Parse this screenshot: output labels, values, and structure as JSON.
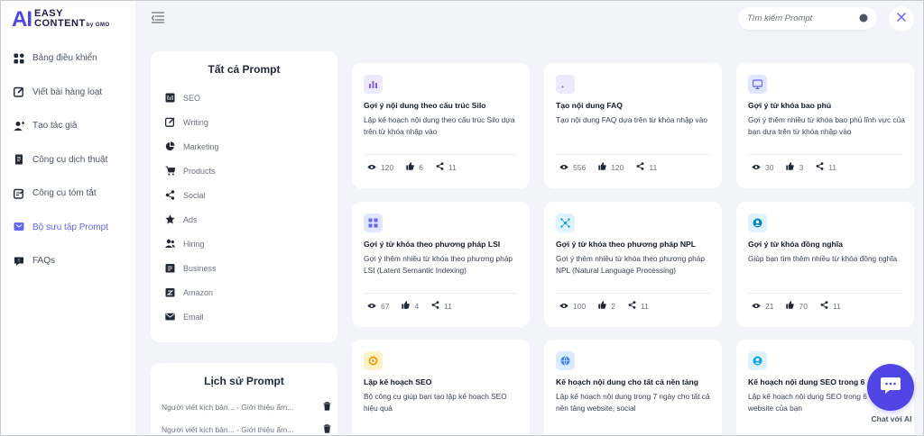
{
  "brand": {
    "mark": "AI",
    "line1": "EASY",
    "line2": "CONTENT",
    "sub": "by GMO"
  },
  "sidebar": {
    "items": [
      {
        "label": "Bảng điều khiển",
        "icon": "dashboard-icon"
      },
      {
        "label": "Viết bài hàng loạt",
        "icon": "edit-icon"
      },
      {
        "label": "Tạo tác giả",
        "icon": "user-add-icon"
      },
      {
        "label": "Công cụ dịch thuật",
        "icon": "document-icon"
      },
      {
        "label": "Công cụ tóm tắt",
        "icon": "summary-icon"
      },
      {
        "label": "Bộ sưu tập Prompt",
        "icon": "collection-icon",
        "active": true
      },
      {
        "label": "FAQs",
        "icon": "faq-icon"
      }
    ]
  },
  "search": {
    "placeholder": "Tìm kiếm Prompt"
  },
  "categories": {
    "title": "Tất cả Prompt",
    "items": [
      {
        "label": "SEO",
        "icon": "seo-icon"
      },
      {
        "label": "Writing",
        "icon": "pen-icon"
      },
      {
        "label": "Marketing",
        "icon": "pie-chart-icon"
      },
      {
        "label": "Products",
        "icon": "cart-icon"
      },
      {
        "label": "Social",
        "icon": "share-icon"
      },
      {
        "label": "Ads",
        "icon": "badge-icon"
      },
      {
        "label": "Hiring",
        "icon": "users-icon"
      },
      {
        "label": "Business",
        "icon": "briefcase-icon"
      },
      {
        "label": "Amazon",
        "icon": "amazon-icon"
      },
      {
        "label": "Email",
        "icon": "mail-icon"
      }
    ]
  },
  "history": {
    "title": "Lịch sử Prompt",
    "items": [
      {
        "text": "Người viết kịch bản... - Giới thiệu ẩm..."
      },
      {
        "text": "Người viết kịch bản... - Giới thiệu ẩm..."
      }
    ]
  },
  "cards": [
    {
      "title": "Gợi ý nội dung theo cấu trúc Silo",
      "desc": "Lập kế hoạch nội dung theo cấu trúc Silo dựa trên từ khóa nhập vào",
      "views": "120",
      "likes": "6",
      "shares": "11",
      "icon": "chart-icon",
      "icon_bg": "#ede9fe",
      "icon_color": "#8b5cf6"
    },
    {
      "title": "Tạo nội dung FAQ",
      "desc": "Tạo nội dung FAQ dựa trên từ khóa nhập vào",
      "views": "556",
      "likes": "120",
      "shares": "11",
      "icon": "rocket-icon",
      "icon_bg": "#ede9fe",
      "icon_color": "#8b5cf6"
    },
    {
      "title": "Gợi ý từ khóa bao phủ",
      "desc": "Gợi ý thêm nhiều từ khóa bao phủ lĩnh vực của bạn dựa trên từ khóa nhập vào",
      "views": "30",
      "likes": "3",
      "shares": "11",
      "icon": "monitor-icon",
      "icon_bg": "#e0e7ff",
      "icon_color": "#6366f1"
    },
    {
      "title": "Gợi ý từ khóa theo phương pháp LSI",
      "desc": "Gợi ý thêm nhiều từ khóa theo phương pháp LSI (Latent Semantic Indexing)",
      "views": "67",
      "likes": "4",
      "shares": "11",
      "icon": "grid-icon",
      "icon_bg": "#e0e7ff",
      "icon_color": "#6366f1"
    },
    {
      "title": "Gợi ý từ khóa theo phương pháp NPL",
      "desc": "Gợi ý thêm nhiều từ khóa theo phương pháp NPL (Natural Language Processing)",
      "views": "100",
      "likes": "2",
      "shares": "11",
      "icon": "network-icon",
      "icon_bg": "#e0f2fe",
      "icon_color": "#0ea5e9"
    },
    {
      "title": "Gợi ý từ khóa đồng nghĩa",
      "desc": "Giúp bạn tìm thêm nhiều từ khóa đồng nghĩa",
      "views": "21",
      "likes": "70",
      "shares": "11",
      "icon": "people-icon",
      "icon_bg": "#e0f2fe",
      "icon_color": "#0284c7"
    },
    {
      "title": "Lập kế hoạch SEO",
      "desc": "Bộ công cụ giúp bạn tạo lập kế hoạch SEO hiệu quả",
      "views": "",
      "likes": "",
      "shares": "",
      "icon": "target-icon",
      "icon_bg": "#fef3c7",
      "icon_color": "#f59e0b"
    },
    {
      "title": "Kế hoạch nội dung cho tất cả nền tảng",
      "desc": "Lập kế hoạch nội dung trong 7 ngày cho tất cả nền tảng website, social",
      "views": "",
      "likes": "",
      "shares": "",
      "icon": "globe-icon",
      "icon_bg": "#dbeafe",
      "icon_color": "#3b82f6"
    },
    {
      "title": "Kế hoạch nội dung SEO trong 6",
      "desc": "Lập kế hoạch nội dung SEO trong 6 cho website của bạn",
      "views": "",
      "likes": "",
      "shares": "",
      "icon": "user-circle-icon",
      "icon_bg": "#e0f2fe",
      "icon_color": "#0ea5e9"
    }
  ],
  "chat": {
    "label": "Chat với AI"
  },
  "colors": {
    "accent": "#4f46e5",
    "active_nav": "#6366f1"
  }
}
